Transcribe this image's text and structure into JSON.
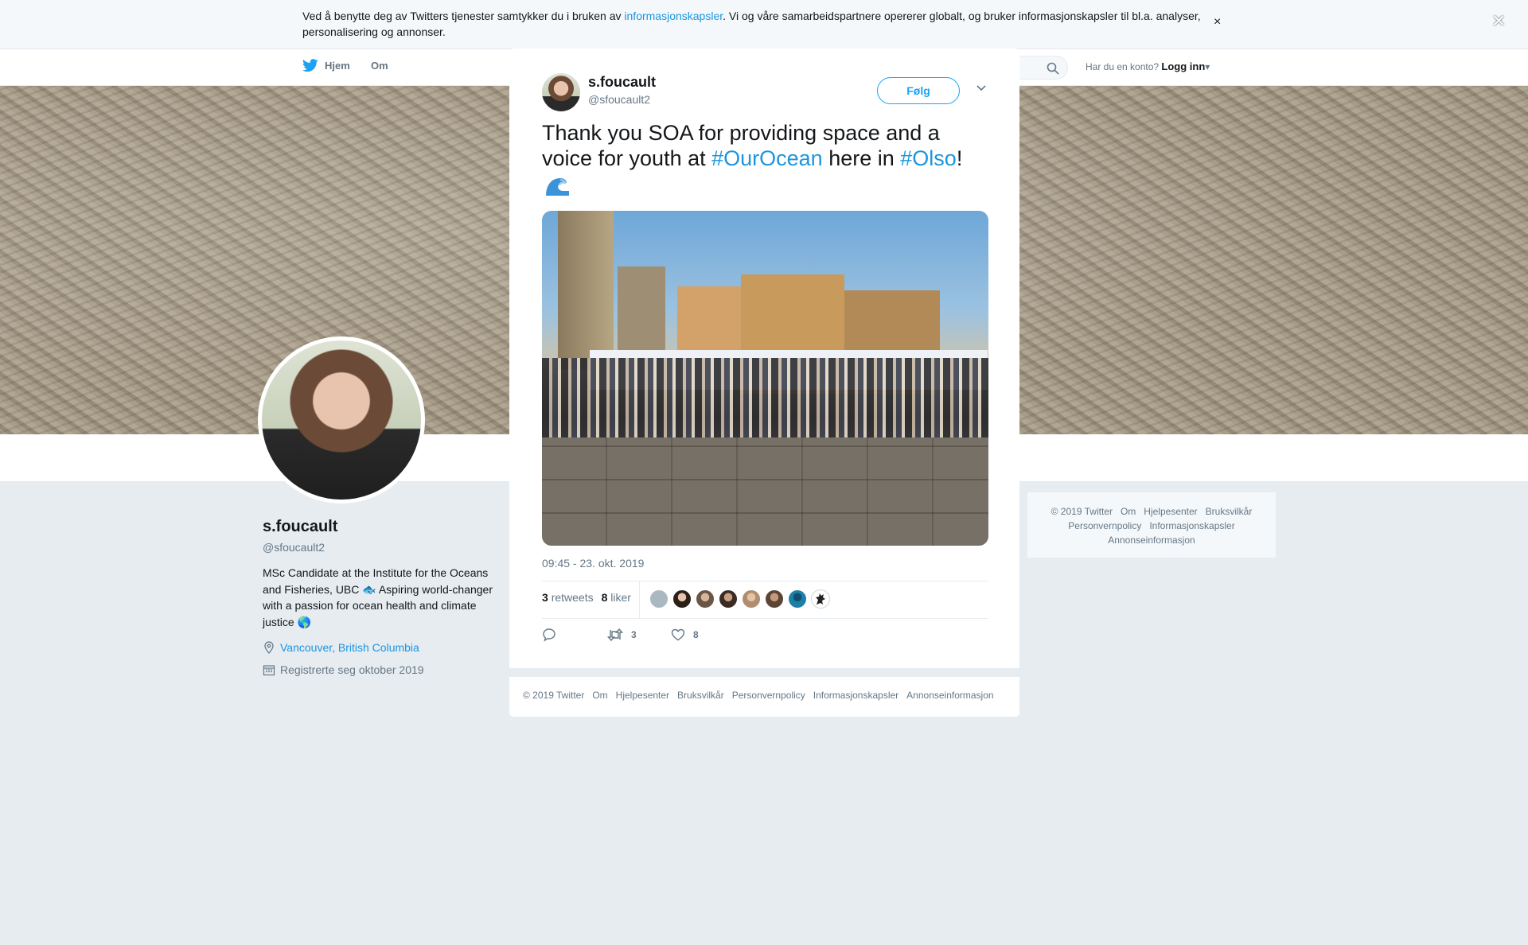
{
  "cookie": {
    "text_before": "Ved å benytte deg av Twitters tjenester samtykker du i bruken av ",
    "link": "informasjonskapsler",
    "text_after": ". Vi og våre samarbeidspartnere opererer globalt, og bruker informasjonskapsler til bl.a. analyser, personalisering og annonser.",
    "close": "×"
  },
  "nav": {
    "home": "Hjem",
    "about": "Om",
    "have_account": "Har du en konto?",
    "login": "Logg inn"
  },
  "profile": {
    "name": "s.foucault",
    "handle": "@sfoucault2",
    "bio": "MSc Candidate at the Institute for the Oceans and Fisheries, UBC 🐟 Aspiring world-changer with a passion for ocean health and climate justice 🌎",
    "location": "Vancouver, British Columbia",
    "joined": "Registrerte seg oktober 2019"
  },
  "side_footer": {
    "items": [
      "© 2019 Twitter",
      "Om",
      "Hjelpesenter",
      "Bruksvilkår",
      "Personvernpolicy",
      "Informasjonskapsler",
      "Annonseinformasjon"
    ]
  },
  "overlay": {
    "close": "×"
  },
  "tweet": {
    "name": "s.foucault",
    "handle": "@sfoucault2",
    "follow": "Følg",
    "text_1": "Thank you SOA for providing space and a voice for youth at ",
    "tag_1": "#OurOcean",
    "text_2": " here in ",
    "tag_2": "#Olso",
    "text_3": "!",
    "time": "09:45 - 23. okt. 2019",
    "retweets_count": "3",
    "retweets_label": "retweets",
    "likes_count": "8",
    "likes_label": "liker",
    "action_retweets": "3",
    "action_likes": "8",
    "liker_colors": [
      "#aab8c2",
      "#3d2b22",
      "#6b5544",
      "#4a3a30",
      "#b08d6e",
      "#5c4535",
      "#1d7fa8",
      "#ffffff"
    ]
  },
  "modal_footer": {
    "items": [
      "© 2019 Twitter",
      "Om",
      "Hjelpesenter",
      "Bruksvilkår",
      "Personvernpolicy",
      "Informasjonskapsler",
      "Annonseinformasjon"
    ]
  },
  "colors": {
    "accent": "#1da1f2",
    "link": "#1b95e0",
    "muted": "#657786"
  }
}
